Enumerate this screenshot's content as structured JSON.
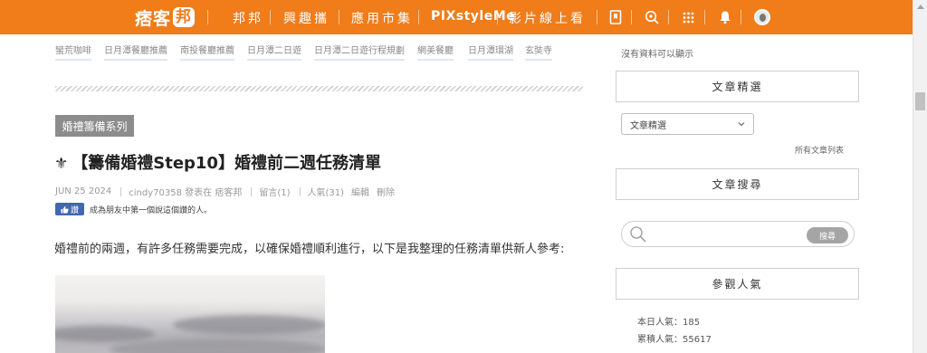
{
  "header": {
    "logo_text": "痞客",
    "logo_badge": "邦",
    "nav": [
      "邦邦",
      "興趣攜",
      "應用市集",
      "PIXstyleMe",
      "影片線上看"
    ],
    "icons": [
      "bookmark-icon",
      "search-icon",
      "apps-grid-icon",
      "bell-icon",
      "avatar"
    ]
  },
  "tags": [
    "蠻荒咖啡",
    "日月潭餐廳推薦",
    "南投餐廳推薦",
    "日月潭二日遊",
    "日月潭二日遊行程規劃",
    "網美餐廳",
    "日月潭環湖",
    "玄奘寺"
  ],
  "article": {
    "category": "婚禮籌備系列",
    "title_icon": "⚜",
    "title": "【籌備婚禮Step10】婚禮前二週任務清單",
    "meta": {
      "date": "JUN 25 2024",
      "author_line": "cindy70358 發表在 痞客邦",
      "comments": "留言(1)",
      "views": "人氣(31)",
      "edit": "編輯",
      "delete": "刪除"
    },
    "like_label": "讚",
    "like_text": "成為朋友中第一個說這個讚的人。",
    "intro": "婚禮前的兩週，有許多任務需要完成，以確保婚禮順利進行，以下是我整理的任務清單供新人參考:"
  },
  "sidebar": {
    "no_data": "沒有資料可以顯示",
    "featured_title": "文章精選",
    "featured_select": "文章精選",
    "all_posts_link": "所有文章列表",
    "search_title": "文章搜尋",
    "search_placeholder": "",
    "search_button": "搜尋",
    "popularity_title": "參觀人氣",
    "today_views": "本日人氣：185",
    "total_views": "累積人氣：55617"
  },
  "colors": {
    "brand_orange": "#f07c1a",
    "like_blue": "#4267b2",
    "category_gray": "#8c8c8c"
  }
}
